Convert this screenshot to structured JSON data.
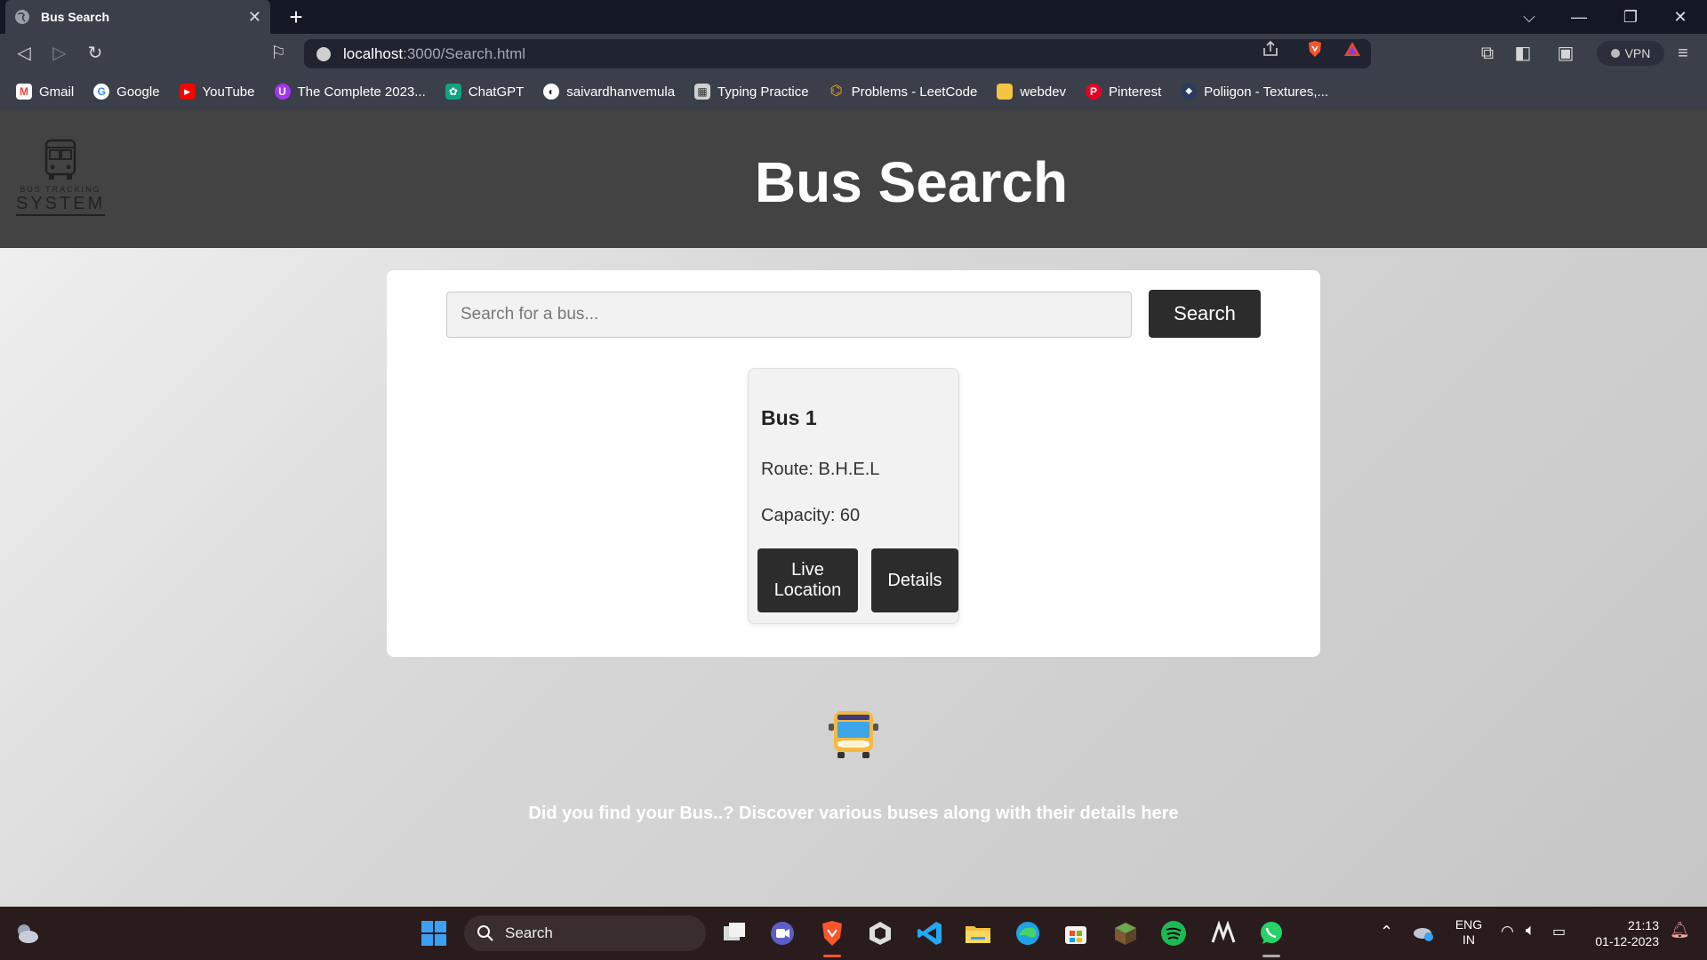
{
  "browser": {
    "tab_title": "Bus Search",
    "url_host": "localhost",
    "url_path": ":3000/Search.html",
    "vpn_label": "VPN",
    "bookmarks": [
      {
        "label": "Gmail",
        "color": "#ea4335",
        "glyph": "M"
      },
      {
        "label": "Google",
        "color": "#4285f4",
        "glyph": "G"
      },
      {
        "label": "YouTube",
        "color": "#ff0000",
        "glyph": "▶"
      },
      {
        "label": "The Complete 2023...",
        "color": "#a435f0",
        "glyph": "U"
      },
      {
        "label": "ChatGPT",
        "color": "#10a37f",
        "glyph": "✿"
      },
      {
        "label": "saivardhanvemula",
        "color": "#222222",
        "glyph": "◐"
      },
      {
        "label": "Typing Practice",
        "color": "#555555",
        "glyph": "▦"
      },
      {
        "label": "Problems - LeetCode",
        "color": "#f89f1b",
        "glyph": "⌬"
      },
      {
        "label": "webdev",
        "color": "#f4c542",
        "glyph": "▬"
      },
      {
        "label": "Pinterest",
        "color": "#e60023",
        "glyph": "P"
      },
      {
        "label": "Poliigon - Textures,...",
        "color": "#2a3b5c",
        "glyph": "◆"
      }
    ]
  },
  "page": {
    "header_title": "Bus Search",
    "logo_small": "BUS TRACKING",
    "logo_big": "SYSTEM",
    "search": {
      "placeholder": "Search for a bus...",
      "button_label": "Search"
    },
    "bus_card": {
      "name": "Bus 1",
      "route": "Route: B.H.E.L",
      "capacity": "Capacity: 60",
      "live_button": "Live Location",
      "details_button": "Details"
    },
    "tagline": "Did you find your Bus..? Discover various buses along with their details here"
  },
  "taskbar": {
    "search_label": "Search",
    "lang_top": "ENG",
    "lang_bottom": "IN",
    "time": "21:13",
    "date": "01-12-2023"
  }
}
